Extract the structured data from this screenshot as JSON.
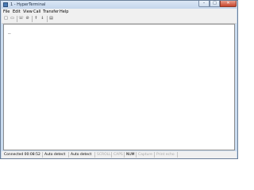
{
  "window": {
    "title": "1 - HyperTerminal",
    "controls": {
      "minimize": "–",
      "maximize": "□",
      "close": "✕"
    }
  },
  "menu": [
    "File",
    "Edit",
    "View",
    "Call",
    "Transfer",
    "Help"
  ],
  "toolbar": [
    {
      "name": "new-connection-icon",
      "glyph": "□"
    },
    {
      "name": "open-icon",
      "glyph": "▭"
    },
    {
      "name": "call-icon",
      "glyph": "☏"
    },
    {
      "name": "disconnect-icon",
      "glyph": "⊘"
    },
    {
      "name": "send-icon",
      "glyph": "⇑"
    },
    {
      "name": "receive-icon",
      "glyph": "⇓"
    },
    {
      "name": "properties-icon",
      "glyph": "▤"
    }
  ],
  "terminal": {
    "cursor": "_"
  },
  "status": {
    "connected": "Connected 00:08:52",
    "detect1": "Auto detect",
    "detect2": "Auto detect",
    "scroll": "SCROLL",
    "caps": "CAPS",
    "num": "NUM",
    "capture": "Capture",
    "print_echo": "Print echo"
  },
  "colors": {
    "frame": "#c9dbef",
    "close_button": "#c8452c",
    "terminal_bg": "#ffffff",
    "status_dim": "#a8a8a8"
  }
}
